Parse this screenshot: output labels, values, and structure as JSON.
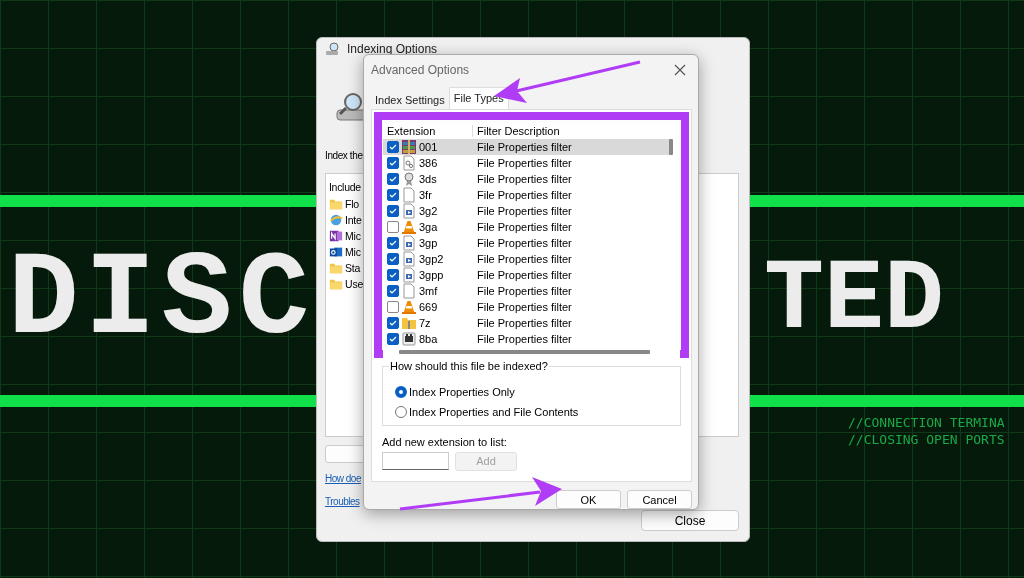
{
  "background": {
    "headline_left": "DISC",
    "headline_right": "TED",
    "terminal_lines": [
      "//CONNECTION TERMINA",
      "//CLOSING OPEN PORTS"
    ]
  },
  "indexing_window": {
    "title": "Indexing Options",
    "intro": "Index the",
    "list_header": "Include",
    "locations": [
      {
        "label": "Flo",
        "kind": "folder"
      },
      {
        "label": "Inte",
        "kind": "globe"
      },
      {
        "label": "Mic",
        "kind": "note"
      },
      {
        "label": "Mic",
        "kind": "mail"
      },
      {
        "label": "Sta",
        "kind": "folder"
      },
      {
        "label": "Use",
        "kind": "folder"
      }
    ],
    "links": [
      "How doe",
      "Troubles"
    ],
    "close_button": "Close"
  },
  "advanced_dialog": {
    "title": "Advanced Options",
    "tabs": [
      {
        "label": "Index Settings",
        "selected": false
      },
      {
        "label": "File Types",
        "selected": true
      }
    ],
    "columns": [
      "Extension",
      "Filter Description"
    ],
    "file_types": [
      {
        "extension": "001",
        "description": "File Properties filter",
        "checked": true,
        "selected": true,
        "kind": "archive"
      },
      {
        "extension": "386",
        "description": "File Properties filter",
        "checked": true,
        "selected": false,
        "kind": "gear"
      },
      {
        "extension": "3ds",
        "description": "File Properties filter",
        "checked": true,
        "selected": false,
        "kind": "badge"
      },
      {
        "extension": "3fr",
        "description": "File Properties filter",
        "checked": true,
        "selected": false,
        "kind": "blank"
      },
      {
        "extension": "3g2",
        "description": "File Properties filter",
        "checked": true,
        "selected": false,
        "kind": "media"
      },
      {
        "extension": "3ga",
        "description": "File Properties filter",
        "checked": false,
        "selected": false,
        "kind": "cone"
      },
      {
        "extension": "3gp",
        "description": "File Properties filter",
        "checked": true,
        "selected": false,
        "kind": "media"
      },
      {
        "extension": "3gp2",
        "description": "File Properties filter",
        "checked": true,
        "selected": false,
        "kind": "media"
      },
      {
        "extension": "3gpp",
        "description": "File Properties filter",
        "checked": true,
        "selected": false,
        "kind": "media"
      },
      {
        "extension": "3mf",
        "description": "File Properties filter",
        "checked": true,
        "selected": false,
        "kind": "blank"
      },
      {
        "extension": "669",
        "description": "File Properties filter",
        "checked": false,
        "selected": false,
        "kind": "cone"
      },
      {
        "extension": "7z",
        "description": "File Properties filter",
        "checked": true,
        "selected": false,
        "kind": "zip"
      },
      {
        "extension": "8ba",
        "description": "File Properties filter",
        "checked": true,
        "selected": false,
        "kind": "app"
      }
    ],
    "index_group": {
      "label": "How should this file be indexed?",
      "options": [
        {
          "label": "Index Properties Only",
          "selected": true
        },
        {
          "label": "Index Properties and File Contents",
          "selected": false
        }
      ]
    },
    "add_label": "Add new extension to list:",
    "add_button": {
      "label": "Add",
      "disabled": true
    },
    "buttons": [
      "OK",
      "Cancel"
    ]
  }
}
